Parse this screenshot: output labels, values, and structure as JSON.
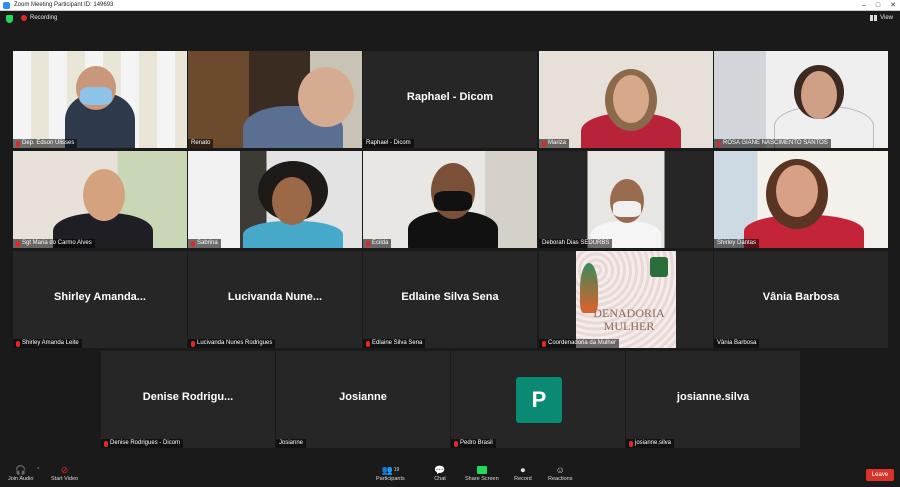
{
  "window": {
    "title": "Zoom Meeting Participant ID: 149693",
    "controls": [
      "–",
      "□",
      "✕"
    ]
  },
  "topbar": {
    "recording_label": "Recording",
    "view_label": "View"
  },
  "tiles": [
    {
      "label": "Dep. Edson Ulisses",
      "muted": true
    },
    {
      "label": "Renato",
      "muted": false
    },
    {
      "big": "Raphael - Dicom",
      "label": "Raphael - Dicom",
      "muted": false
    },
    {
      "label": "Mariza",
      "muted": true
    },
    {
      "label": "ROSA GIANE NASCIMENTO SANTOS",
      "muted": true
    },
    {
      "label": "Sgt Maria do Carmo Alves",
      "muted": true
    },
    {
      "label": "Sabrina",
      "muted": true
    },
    {
      "label": "Ecilda",
      "muted": true
    },
    {
      "label": "Deborah  Dias SEDURBS",
      "muted": false
    },
    {
      "label": "Shirley Dantas",
      "muted": false
    },
    {
      "big": "Shirley  Amanda...",
      "label": "Shirley Amanda Leite",
      "muted": true
    },
    {
      "big": "Lucivanda  Nune...",
      "label": "Lucivanda Nunes Rodrigues",
      "muted": true
    },
    {
      "big": "Edlaine Silva Sena",
      "label": "Edlaine Silva Sena",
      "muted": true
    },
    {
      "label": "Coordenadoria da Mulher",
      "muted": true,
      "logo_text": "DENADORIA MULHER"
    },
    {
      "big": "Vânia Barbosa",
      "label": "Vânia Barbosa",
      "muted": false
    },
    {
      "big": "Denise  Rodrigu...",
      "label": "Denise Rodrigues - Dicom",
      "muted": true
    },
    {
      "big": "Josianne",
      "label": "Josianne",
      "muted": false
    },
    {
      "avatar": "P",
      "label": "Pedro Brasil",
      "muted": true
    },
    {
      "big": "josianne.silva",
      "label": "josianne.silva",
      "muted": true
    }
  ],
  "toolbar": {
    "join_audio": "Join Audio",
    "start_video": "Start Video",
    "participants": "Participants",
    "participants_count": "19",
    "chat": "Chat",
    "share_screen": "Share Screen",
    "record": "Record",
    "reactions": "Reactions",
    "leave": "Leave"
  },
  "colors": {
    "accent_green": "#23d959",
    "leave_red": "#d9342b",
    "active_speaker": "#c4e33a",
    "avatar_teal": "#0a8a72"
  }
}
